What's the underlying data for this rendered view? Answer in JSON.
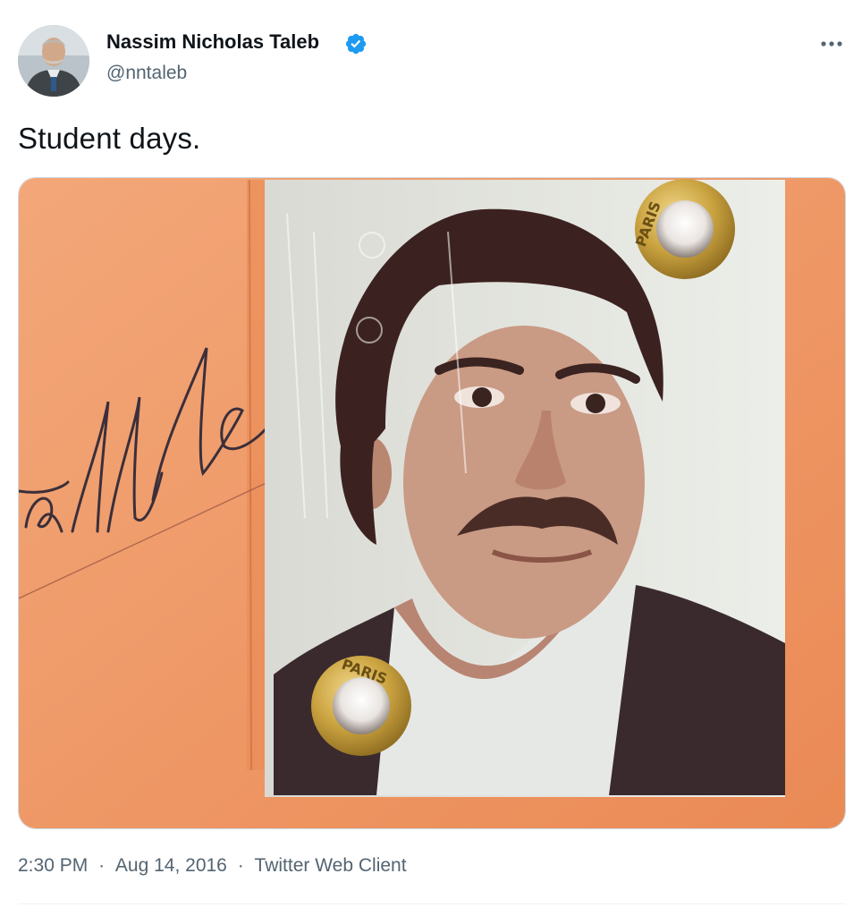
{
  "author": {
    "name": "Nassim Nicholas Taleb",
    "handle": "@nntaleb",
    "verified": true,
    "verified_icon": "verified-badge-icon",
    "verified_color": "#1d9bf0"
  },
  "menu": {
    "icon": "more-horizontal-icon"
  },
  "tweet": {
    "text": "Student days."
  },
  "media": {
    "description_icon": "photo-image",
    "stamp_text": "PARIS",
    "signature_text": "Talib"
  },
  "meta": {
    "time": "2:30 PM",
    "separator": "·",
    "date": "Aug 14, 2016",
    "source": "Twitter Web Client"
  },
  "colors": {
    "text_primary": "#0f1419",
    "text_secondary": "#536471",
    "border": "#cfd9de",
    "card_orange": "#ec9060"
  }
}
